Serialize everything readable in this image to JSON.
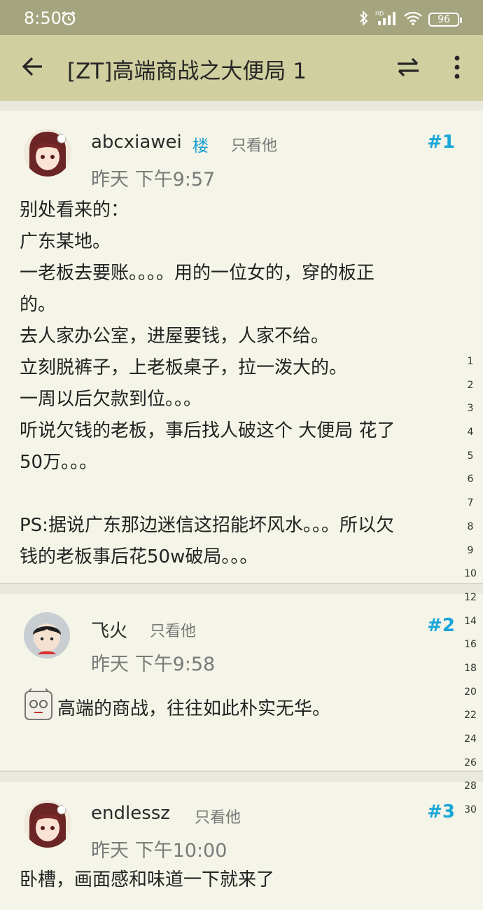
{
  "status": {
    "time": "8:50",
    "battery": "96",
    "network": "HD"
  },
  "toolbar": {
    "title": "[ZT]高端商战之大便局  1"
  },
  "posts": [
    {
      "user": "abcxiawei",
      "badge": "楼",
      "only_him": "只看他",
      "floor": "#1",
      "time": "昨天 下午9:57",
      "lines": [
        "别处看来的：",
        "广东某地。",
        "一老板去要账。。。。用的一位女的，穿的板正",
        "的。",
        "去人家办公室，进屋要钱，人家不给。",
        "立刻脱裤子，上老板桌子，拉一泼大的。",
        "一周以后欠款到位。。。",
        "听说欠钱的老板，事后找人破这个 大便局 花了",
        "50万。。。",
        "",
        "PS:据说广东那边迷信这招能坏风水。。。所以欠",
        "钱的老板事后花50w破局。。。"
      ]
    },
    {
      "user": "飞火",
      "only_him": "只看他",
      "floor": "#2",
      "time": "昨天 下午9:58",
      "text": "高端的商战，往往如此朴实无华。"
    },
    {
      "user": "endlessz",
      "only_him": "只看他",
      "floor": "#3",
      "time": "昨天 下午10:00",
      "text": "卧槽，画面感和味道一下就来了"
    }
  ],
  "page_index": [
    "1",
    "2",
    "3",
    "4",
    "5",
    "6",
    "7",
    "8",
    "9",
    "10",
    "12",
    "14",
    "16",
    "18",
    "20",
    "22",
    "24",
    "26",
    "28",
    "30"
  ],
  "colors": {
    "status_bar": "#a4a47e",
    "toolbar": "#cfcf9f",
    "card": "#f4f4e8",
    "floor": "#18a6d8"
  }
}
